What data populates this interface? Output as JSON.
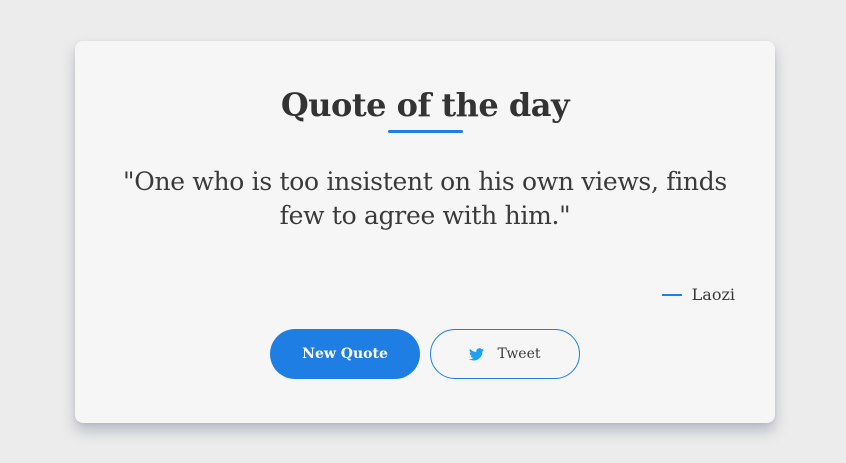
{
  "card": {
    "title": "Quote of the day",
    "quote": "\"One who is too insistent on his own views, finds few to agree with him.\"",
    "author": "Laozi"
  },
  "buttons": {
    "new_quote_label": "New Quote",
    "tweet_label": "Tweet",
    "tweet_icon": "twitter-bird-icon"
  },
  "colors": {
    "accent": "#1f7ee4",
    "twitter": "#1da1f2",
    "text": "#333333",
    "background": "#ececec",
    "card": "#f6f6f6"
  }
}
